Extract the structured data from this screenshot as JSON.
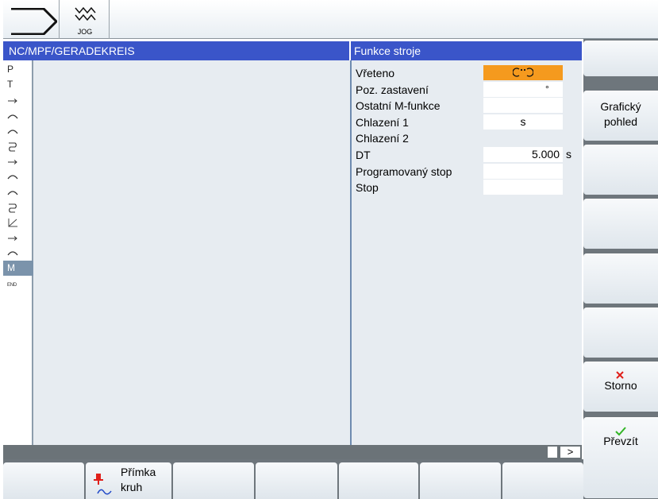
{
  "topbar": {
    "mode_label": "JOG"
  },
  "header": {
    "program_path": "NC/MPF/GERADEKREIS",
    "panel_title": "Funkce stroje"
  },
  "editor": {
    "blocks": [
      {
        "text": "P",
        "kind": "text"
      },
      {
        "text": "T",
        "kind": "text"
      },
      {
        "text": "",
        "kind": "line-icon"
      },
      {
        "text": "",
        "kind": "arc-icon"
      },
      {
        "text": "",
        "kind": "arc-icon"
      },
      {
        "text": "",
        "kind": "cycle-icon"
      },
      {
        "text": "",
        "kind": "line-icon"
      },
      {
        "text": "",
        "kind": "arc-icon"
      },
      {
        "text": "",
        "kind": "arc-icon"
      },
      {
        "text": "",
        "kind": "cycle-icon"
      },
      {
        "text": "",
        "kind": "chamfer-icon"
      },
      {
        "text": "",
        "kind": "line-icon"
      },
      {
        "text": "",
        "kind": "arc-icon"
      },
      {
        "text": "M",
        "kind": "text",
        "selected": true
      },
      {
        "text": "END",
        "kind": "tiny"
      }
    ]
  },
  "form": {
    "rows": [
      {
        "label": "Vřeteno",
        "value": "",
        "unit": "",
        "field": "spindle"
      },
      {
        "label": "Poz. zastavení",
        "value": "",
        "unit": "°",
        "field": "stop"
      },
      {
        "label": "Ostatní M-funkce",
        "value": "",
        "unit": "",
        "field": "plain"
      },
      {
        "label": "Chlazení 1",
        "value": "s",
        "unit": "",
        "field": "center"
      },
      {
        "label": "Chlazení 2",
        "value": "",
        "unit": "",
        "field": "none"
      },
      {
        "label": "DT",
        "value": "5.000",
        "unit": "s",
        "field": "value"
      },
      {
        "label": "Programovaný stop",
        "value": "",
        "unit": "",
        "field": "plain"
      },
      {
        "label": "Stop",
        "value": "",
        "unit": "",
        "field": "plain"
      }
    ]
  },
  "statusbar": {
    "next_label": ">"
  },
  "vertical_softkeys": [
    {
      "label": ""
    },
    {
      "label": "Grafický\npohled"
    },
    {
      "label": ""
    },
    {
      "label": ""
    },
    {
      "label": ""
    },
    {
      "label": ""
    },
    {
      "label": "Storno",
      "icon": "cross-icon"
    },
    {
      "label": "Převzít",
      "icon": "check-icon"
    }
  ],
  "horizontal_softkeys": [
    {
      "label": ""
    },
    {
      "label": "Přímka\nkruh",
      "icon": "line-circle-icon"
    },
    {
      "label": ""
    },
    {
      "label": ""
    },
    {
      "label": ""
    },
    {
      "label": ""
    },
    {
      "label": ""
    }
  ],
  "colors": {
    "title_bar": "#3a55c9",
    "active_field": "#f59a1e",
    "selected_block": "#7b93ab",
    "cancel_icon": "#e0201b",
    "ok_icon": "#33b526"
  }
}
